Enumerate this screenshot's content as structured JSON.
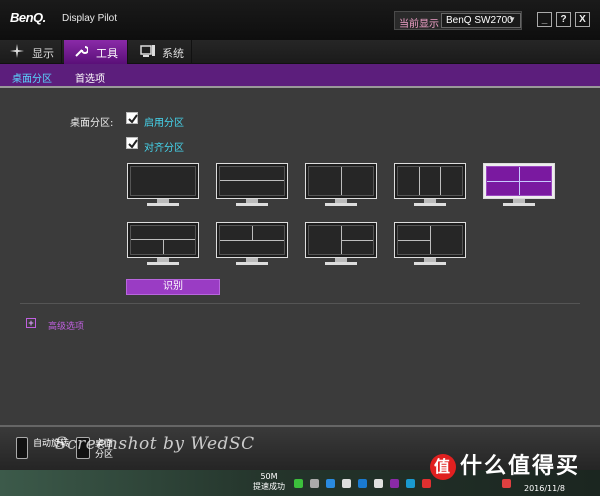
{
  "app": {
    "logo": "BenQ.",
    "title": "Display Pilot",
    "current_display_label": "当前显示",
    "current_display_value": "BenQ SW2700"
  },
  "window_buttons": {
    "minimize": "_",
    "help": "?",
    "close": "X"
  },
  "tabs": [
    {
      "label": "显示",
      "icon": "sparkle-icon",
      "active": false
    },
    {
      "label": "工具",
      "icon": "wrench-icon",
      "active": true
    },
    {
      "label": "系统",
      "icon": "system-icon",
      "active": false
    }
  ],
  "subnav": [
    {
      "label": "桌面分区",
      "active": true
    },
    {
      "label": "首选项",
      "active": false
    }
  ],
  "partition": {
    "label": "桌面分区:",
    "enable_label": "启用分区",
    "enable_checked": true,
    "align_label": "对齐分区",
    "align_checked": true,
    "identify_button": "识别",
    "selected_layout_index": 4,
    "layouts_count": 9
  },
  "advanced": {
    "expander": "+",
    "label": "高级选项"
  },
  "bottom": {
    "rotate_label": "自动旋转",
    "desk_label": "桌面",
    "desk_label2": "分区"
  },
  "watermark": "Screenshot by WedSC",
  "taskbar": {
    "network_speed": "50M",
    "network_status": "提速成功",
    "date": "2016/11/8"
  },
  "site_brand": "什么值得买",
  "site_logo": "值",
  "colors": {
    "accent": "#7a19a0",
    "tab_active": "#8a2aa8",
    "subnav_bg": "#5c1e7c",
    "checkbox_label": "#46d8f0"
  }
}
